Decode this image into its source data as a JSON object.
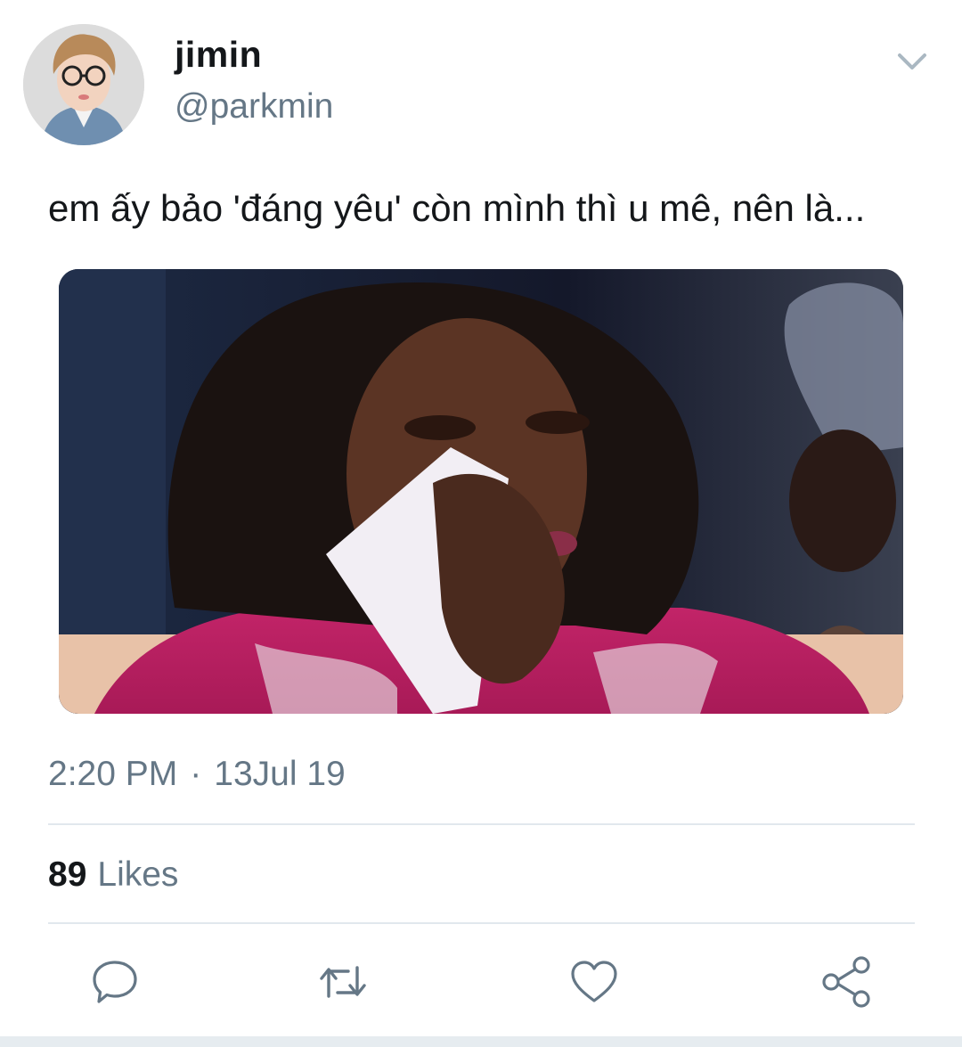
{
  "author": {
    "display_name": "jimin",
    "handle": "@parkmin"
  },
  "tweet": {
    "text": "em ấy bảo 'đáng yêu' còn mình thì u mê, nên là...",
    "time": "2:20 PM",
    "separator": "·",
    "date": "13Jul 19"
  },
  "stats": {
    "likes_count": "89",
    "likes_label": "Likes"
  },
  "icons": {
    "menu": "chevron-down-icon",
    "reply": "reply-icon",
    "retweet": "retweet-icon",
    "like": "heart-icon",
    "share": "share-icon"
  },
  "colors": {
    "text_primary": "#14171a",
    "text_secondary": "#657786",
    "divider": "#e1e8ed",
    "icon": "#657786"
  }
}
